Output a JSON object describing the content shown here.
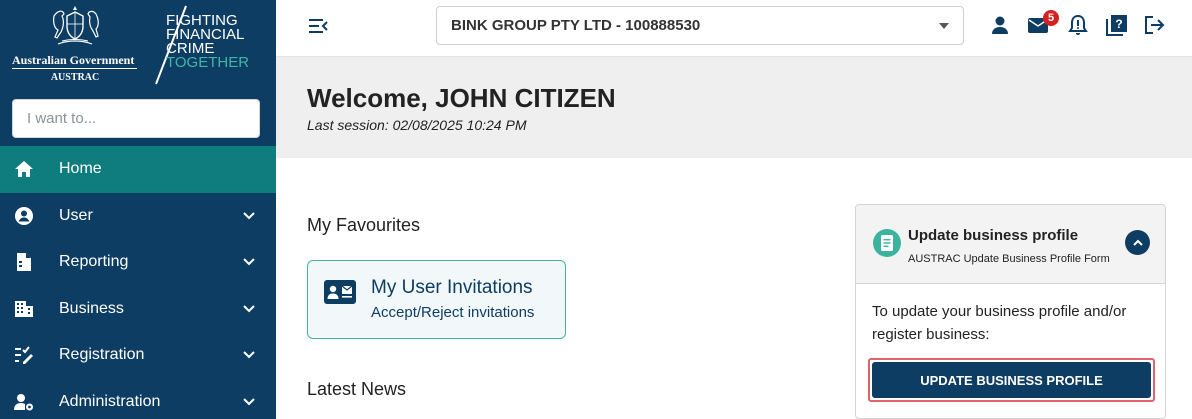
{
  "brand": {
    "government": "Australian Government",
    "agency": "AUSTRAC",
    "tagline_lines": [
      "FIGHTING",
      "FINANCIAL",
      "CRIME"
    ],
    "tagline_accent": "TOGETHER"
  },
  "search": {
    "placeholder": "I want to..."
  },
  "sidebar": {
    "items": [
      {
        "label": "Home",
        "icon": "home-icon",
        "active": true
      },
      {
        "label": "User",
        "icon": "user-icon",
        "active": false
      },
      {
        "label": "Reporting",
        "icon": "reporting-icon",
        "active": false
      },
      {
        "label": "Business",
        "icon": "business-icon",
        "active": false
      },
      {
        "label": "Registration",
        "icon": "registration-icon",
        "active": false
      },
      {
        "label": "Administration",
        "icon": "administration-icon",
        "active": false
      }
    ]
  },
  "topbar": {
    "organisation": "BINK GROUP PTY LTD - 100888530",
    "mail_count": "5",
    "icons": [
      "user-icon",
      "mail-icon",
      "bell-icon",
      "help-icon",
      "logout-icon"
    ]
  },
  "welcome": {
    "greeting": "Welcome, JOHN CITIZEN",
    "last_session": "Last session: 02/08/2025 10:24 PM"
  },
  "main": {
    "favourites_heading": "My Favourites",
    "favourite": {
      "title": "My User Invitations",
      "subtitle": "Accept/Reject invitations"
    },
    "news_heading": "Latest News"
  },
  "panel": {
    "title": "Update business profile",
    "subtitle": "AUSTRAC Update Business Profile Form",
    "body": "To update your business profile and/or register business:",
    "button_label": "UPDATE BUSINESS PROFILE"
  },
  "colors": {
    "sidebar": "#0d3d63",
    "active": "#0f7c7e",
    "accent": "#41b6a8",
    "badge": "#d62020",
    "highlight": "#e0636a"
  }
}
